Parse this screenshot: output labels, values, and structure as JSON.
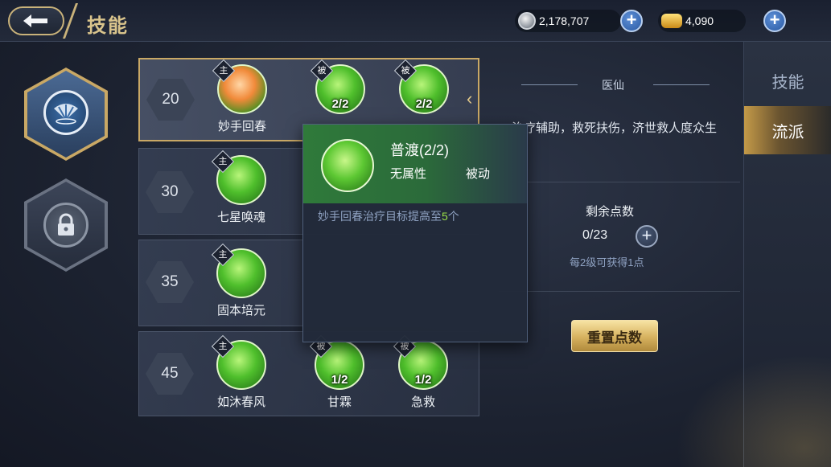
{
  "header": {
    "title": "技能",
    "currencies": [
      {
        "name": "silver",
        "value": "2,178,707"
      },
      {
        "name": "gold-ingot",
        "value": "4,090"
      }
    ]
  },
  "left_tabs": [
    {
      "name": "active-school",
      "icon": "fan-icon",
      "state": "selected"
    },
    {
      "name": "locked-school",
      "icon": "lock-icon",
      "state": "locked"
    }
  ],
  "skill_rows": [
    {
      "level": "20",
      "skills": [
        {
          "name": "妙手回春",
          "tag": "主",
          "count": ""
        },
        {
          "name": "",
          "tag": "被",
          "count": "2/2"
        },
        {
          "name": "",
          "tag": "被",
          "count": "2/2"
        }
      ]
    },
    {
      "level": "30",
      "skills": [
        {
          "name": "七星唤魂",
          "tag": "主",
          "count": ""
        }
      ]
    },
    {
      "level": "35",
      "skills": [
        {
          "name": "固本培元",
          "tag": "主",
          "count": ""
        }
      ]
    },
    {
      "level": "45",
      "skills": [
        {
          "name": "如沐春风",
          "tag": "主",
          "count": ""
        },
        {
          "name": "甘霖",
          "tag": "被",
          "count": "1/2"
        },
        {
          "name": "急救",
          "tag": "被",
          "count": "1/2"
        }
      ]
    }
  ],
  "tooltip": {
    "title": "普渡(2/2)",
    "attribute": "无属性",
    "type": "被动",
    "desc_prefix": "妙手回春治疗目标提高至",
    "desc_highlight": "5",
    "desc_suffix": "个"
  },
  "school": {
    "name": "医仙",
    "description": "治疗辅助，救死扶伤，济世救人度众生"
  },
  "points": {
    "label": "剩余点数",
    "value": "0/23",
    "hint": "每2级可获得1点",
    "reset_label": "重置点数"
  },
  "right_tabs": [
    {
      "label": "技能",
      "selected": false
    },
    {
      "label": "流派",
      "selected": true
    }
  ],
  "colors": {
    "accent_gold": "#c9a865",
    "skill_green": "#4fbf2c",
    "highlight_green": "#9be04a"
  }
}
